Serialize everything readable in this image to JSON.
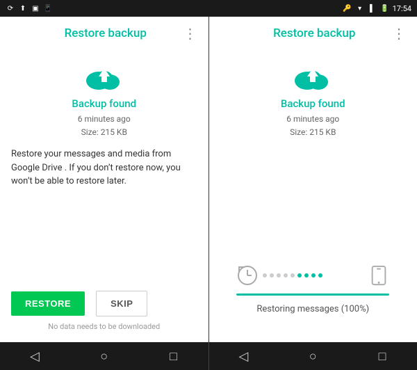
{
  "statusBar": {
    "time": "17:54",
    "leftIcons": [
      "⟳",
      "⬆",
      "⬛",
      "📱"
    ],
    "rightIcons": [
      "🔑",
      "▼",
      "🔋"
    ]
  },
  "leftScreen": {
    "title": "Restore backup",
    "moreIcon": "⋮",
    "cloudAlt": "upload to cloud",
    "backupFound": "Backup found",
    "minutesAgo": "6 minutes ago",
    "size": "Size: 215 KB",
    "description": "Restore your messages and media from Google Drive . If you don’t restore now, you won’t be able to restore later.",
    "restoreLabel": "RESTORE",
    "skipLabel": "SKIP",
    "noDataNote": "No data needs to be downloaded"
  },
  "rightScreen": {
    "title": "Restore backup",
    "moreIcon": "⋮",
    "cloudAlt": "upload to cloud",
    "backupFound": "Backup found",
    "minutesAgo": "6 minutes ago",
    "size": "Size: 215 KB",
    "progressDots": [
      false,
      false,
      false,
      false,
      false,
      true,
      true,
      true,
      true
    ],
    "progressPercent": 100,
    "restoringText": "Restoring messages (100%)"
  },
  "bottomNav": {
    "back": "◁",
    "home": "○",
    "recent": "□"
  },
  "colors": {
    "accent": "#00bfa5",
    "green": "#00c853",
    "gray": "#aaaaaa"
  }
}
